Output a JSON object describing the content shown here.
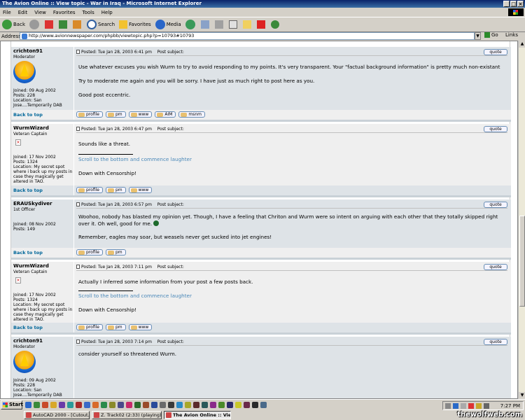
{
  "window": {
    "title": "The Avion Online :: View topic - War in Iraq - Microsoft Internet Explorer"
  },
  "menu": [
    "File",
    "Edit",
    "View",
    "Favorites",
    "Tools",
    "Help"
  ],
  "toolbar": {
    "back": "Back",
    "search": "Search",
    "favorites": "Favorites",
    "media": "Media"
  },
  "address": {
    "label": "Address",
    "url": "http://www.avionnewspaper.com/phpbb/viewtopic.php?p=10793#10793",
    "go": "Go",
    "links": "Links"
  },
  "common": {
    "back_to_top": "Back to top",
    "quote": "quote",
    "posted_prefix": "Posted: ",
    "post_subject": "Post subject:",
    "btn_profile": "profile",
    "btn_pm": "pm",
    "btn_www": "www",
    "btn_aim": "AIM",
    "btn_msnm": "msnm"
  },
  "posts": [
    {
      "username": "crichton91",
      "rank": "Moderator",
      "joined": "Joined: 09 Aug 2002",
      "posts": "Posts: 228",
      "location": "Location: San Jose....Temporarily DAB",
      "date": "Tue Jan 28, 2003 6:41 pm",
      "body1": "Use whatever excuses you wish Wurm to try to avoid responding to my points. It's very transparent. Your \"factual background information\" is pretty much non-existant",
      "body2": "Try to moderate me again and you will be sorry. I have just as much right to post here as you.",
      "body3": "Good post eccentric."
    },
    {
      "username": "WurmWizard",
      "rank": "Veteran Captain",
      "joined": "Joined: 17 Nov 2002",
      "posts": "Posts: 1324",
      "location": "Location: My secret spot where i back up my posts in case they magically get altered in TAO.",
      "date": "Tue Jan 28, 2003 6:47 pm",
      "body1": "Sounds like a threat.",
      "sig_link": "Scroll to the bottom and commence laughter",
      "sig_text": "Down with Censorship!"
    },
    {
      "username": "ERAUSkydiver",
      "rank": "1st Officer",
      "joined": "Joined: 08 Nov 2002",
      "posts": "Posts: 149",
      "date": "Tue Jan 28, 2003 6:57 pm",
      "body1": "Woohoo, nobody has blasted my opinion yet. Though, I have a feeling that Chriton and Wurm were so intent on arguing with each other that they totally skipped right over it. Oh well, good for me.",
      "body2": "Remember, eagles may soar, but weasels never get sucked into jet engines!"
    },
    {
      "username": "WurmWizard",
      "rank": "Veteran Captain",
      "joined": "Joined: 17 Nov 2002",
      "posts": "Posts: 1324",
      "location": "Location: My secret spot where i back up my posts in case they magically get altered in TAO.",
      "date": "Tue Jan 28, 2003 7:11 pm",
      "body1": "Actually I inferred some information from your post a few posts back.",
      "sig_link": "Scroll to the bottom and commence laughter",
      "sig_text": "Down with Censorship!"
    },
    {
      "username": "crichton91",
      "rank": "Moderator",
      "joined": "Joined: 09 Aug 2002",
      "posts": "Posts: 228",
      "location": "Location: San Jose....Temporarily DAB",
      "date": "Tue Jan 28, 2003 7:14 pm",
      "body1": "consider yourself so threatened Wurm."
    }
  ],
  "taskbar": {
    "start": "Start",
    "tasks": [
      "AutoCAD 2000 - [Cutout...",
      "Z. Track02 (2:33) (playing)",
      "The Avion Online :: Vie..."
    ],
    "clock": "7:27 PM",
    "watermark": "thewolfweb.com"
  }
}
